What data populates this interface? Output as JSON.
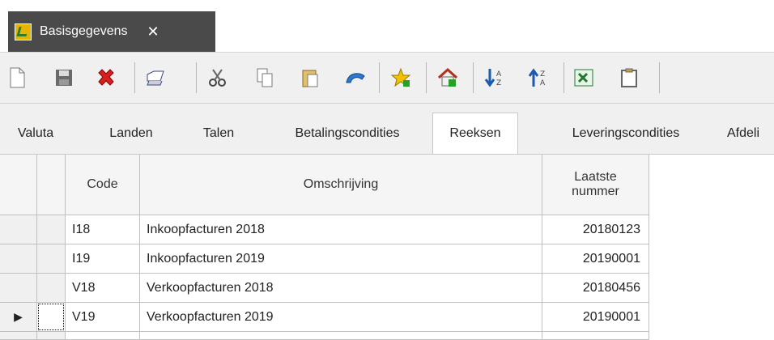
{
  "document_tab": {
    "title": "Basisgegevens",
    "close_symbol": "✕"
  },
  "toolbar": {
    "icons": [
      "new-document-icon",
      "save-icon",
      "delete-icon",
      "print-icon",
      "cut-icon",
      "copy-icon",
      "paste-icon",
      "undo-icon",
      "favorite-icon",
      "home-icon",
      "sort-ascending-icon",
      "sort-descending-icon",
      "excel-export-icon",
      "clipboard-icon"
    ]
  },
  "content_tabs": [
    {
      "label": "Valuta",
      "active": false
    },
    {
      "label": "Landen",
      "active": false
    },
    {
      "label": "Talen",
      "active": false
    },
    {
      "label": "Betalingscondities",
      "active": false
    },
    {
      "label": "Reeksen",
      "active": true
    },
    {
      "label": "Leveringscondities",
      "active": false
    },
    {
      "label": "Afdeli",
      "active": false
    }
  ],
  "grid": {
    "columns": {
      "code": "Code",
      "description": "Omschrijving",
      "last_number_line1": "Laatste",
      "last_number_line2": "nummer"
    },
    "rows": [
      {
        "code": "I18",
        "description": "Inkoopfacturen 2018",
        "last_number": "20180123"
      },
      {
        "code": "I19",
        "description": "Inkoopfacturen 2019",
        "last_number": "20190001"
      },
      {
        "code": "V18",
        "description": "Verkoopfacturen 2018",
        "last_number": "20180456"
      },
      {
        "code": "V19",
        "description": "Verkoopfacturen 2019",
        "last_number": "20190001"
      }
    ],
    "current_row_indicator": "▶"
  },
  "colors": {
    "tab_dark": "#4a4a4a",
    "toolbar_bg": "#f0f0f0",
    "grid_line": "#c0c0c0"
  }
}
